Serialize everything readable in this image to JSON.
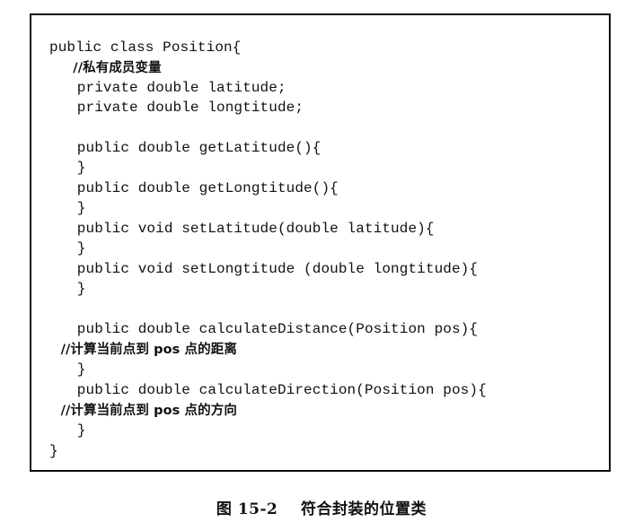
{
  "code": {
    "lines": [
      "public class Position{",
      "  //私有成员变量",
      "    private double latitude;",
      "    private double longtitude;",
      "",
      "    public double getLatitude(){",
      "    }",
      "    public double getLongtitude(){",
      "    }",
      "    public void setLatitude(double latitude){",
      "    }",
      "    public void setLongtitude (double longtitude){",
      "    }",
      "",
      "    public double calculateDistance(Position pos){",
      "    //计算当前点到 pos 点的距离",
      "    }",
      "    public double calculateDirection(Position pos){",
      "    //计算当前点到 pos 点的方向",
      "    }",
      "}"
    ]
  },
  "caption": "图 15-2    符合封装的位置类"
}
